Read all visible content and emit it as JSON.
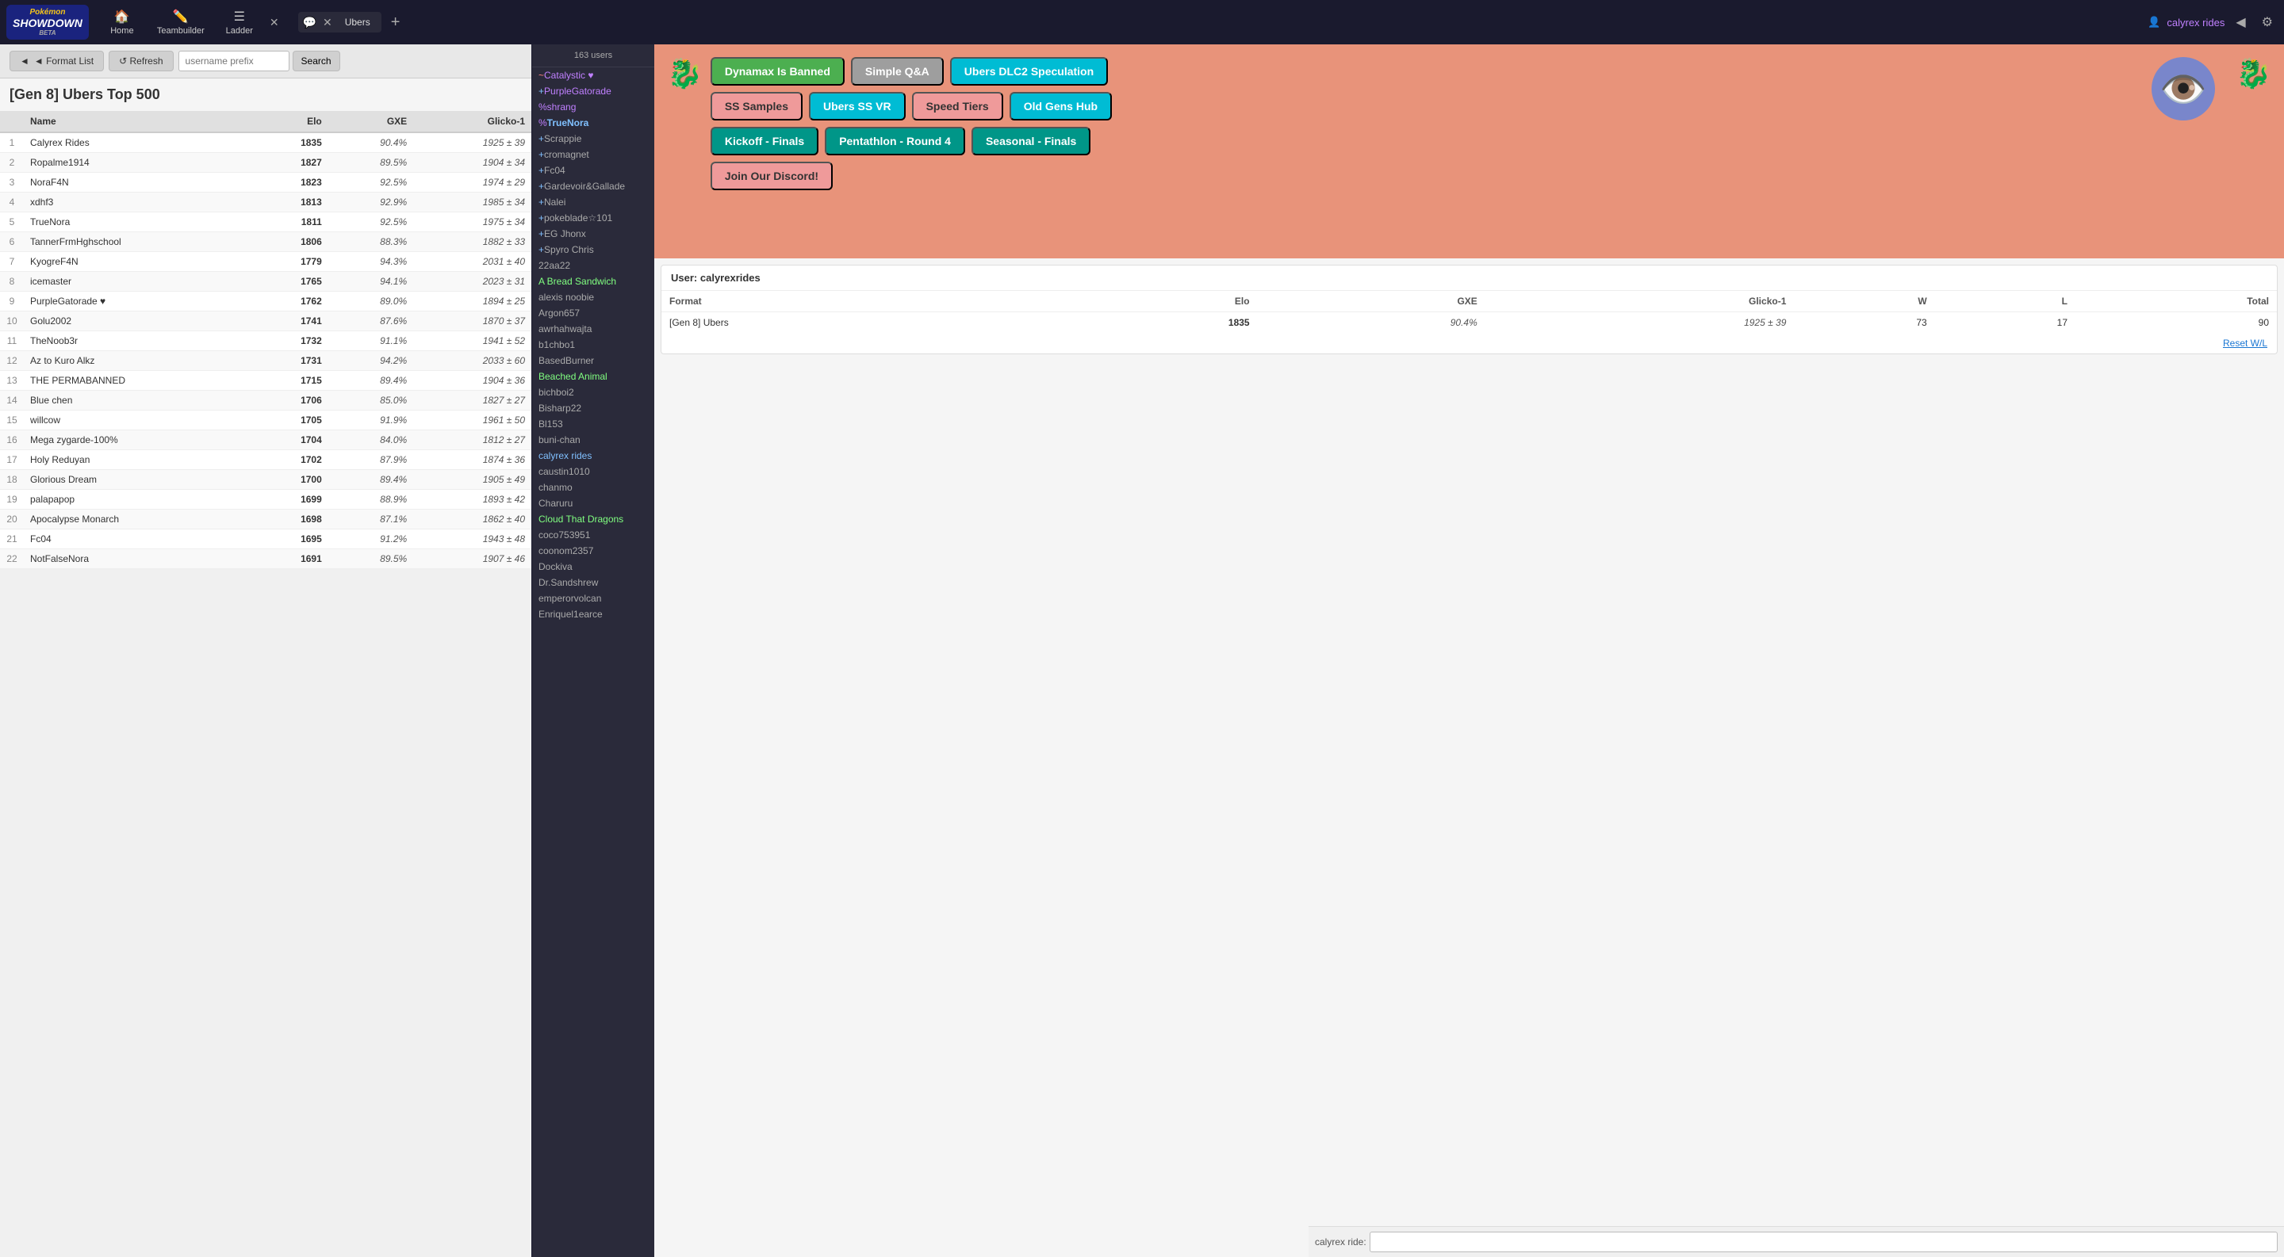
{
  "logo": {
    "pokemon": "Pokémon",
    "showdown": "SHOWDOWN",
    "beta": "BETA"
  },
  "nav": {
    "home_label": "Home",
    "teambuilder_label": "Teambuilder",
    "ladder_label": "Ladder",
    "ubers_tab": "Ubers",
    "add_tab": "+"
  },
  "user": {
    "name": "calyrex rides",
    "icon": "👤"
  },
  "toolbar": {
    "format_list_label": "◄ Format List",
    "refresh_label": "↺ Refresh",
    "search_placeholder": "username prefix",
    "search_label": "Search"
  },
  "ladder": {
    "title": "[Gen 8] Ubers Top 500",
    "columns": {
      "rank": "",
      "name": "Name",
      "elo": "Elo",
      "gxe": "GXE",
      "glicko": "Glicko-1"
    },
    "rows": [
      {
        "rank": 1,
        "name": "Calyrex Rides",
        "elo": "1835",
        "gxe": "90.4%",
        "glicko": "1925 ± 39"
      },
      {
        "rank": 2,
        "name": "Ropalme1914",
        "elo": "1827",
        "gxe": "89.5%",
        "glicko": "1904 ± 34"
      },
      {
        "rank": 3,
        "name": "NoraF4N",
        "elo": "1823",
        "gxe": "92.5%",
        "glicko": "1974 ± 29"
      },
      {
        "rank": 4,
        "name": "xdhf3",
        "elo": "1813",
        "gxe": "92.9%",
        "glicko": "1985 ± 34"
      },
      {
        "rank": 5,
        "name": "TrueNora",
        "elo": "1811",
        "gxe": "92.5%",
        "glicko": "1975 ± 34"
      },
      {
        "rank": 6,
        "name": "TannerFrmHghschool",
        "elo": "1806",
        "gxe": "88.3%",
        "glicko": "1882 ± 33"
      },
      {
        "rank": 7,
        "name": "KyogreF4N",
        "elo": "1779",
        "gxe": "94.3%",
        "glicko": "2031 ± 40"
      },
      {
        "rank": 8,
        "name": "icemaster",
        "elo": "1765",
        "gxe": "94.1%",
        "glicko": "2023 ± 31"
      },
      {
        "rank": 9,
        "name": "PurpleGatorade ♥",
        "elo": "1762",
        "gxe": "89.0%",
        "glicko": "1894 ± 25"
      },
      {
        "rank": 10,
        "name": "Golu2002",
        "elo": "1741",
        "gxe": "87.6%",
        "glicko": "1870 ± 37"
      },
      {
        "rank": 11,
        "name": "TheNoob3r",
        "elo": "1732",
        "gxe": "91.1%",
        "glicko": "1941 ± 52"
      },
      {
        "rank": 12,
        "name": "Az to Kuro Alkz",
        "elo": "1731",
        "gxe": "94.2%",
        "glicko": "2033 ± 60"
      },
      {
        "rank": 13,
        "name": "THE PERMABANNED",
        "elo": "1715",
        "gxe": "89.4%",
        "glicko": "1904 ± 36"
      },
      {
        "rank": 14,
        "name": "Blue chen",
        "elo": "1706",
        "gxe": "85.0%",
        "glicko": "1827 ± 27"
      },
      {
        "rank": 15,
        "name": "willcow",
        "elo": "1705",
        "gxe": "91.9%",
        "glicko": "1961 ± 50"
      },
      {
        "rank": 16,
        "name": "Mega zygarde-100%",
        "elo": "1704",
        "gxe": "84.0%",
        "glicko": "1812 ± 27"
      },
      {
        "rank": 17,
        "name": "Holy Reduyan",
        "elo": "1702",
        "gxe": "87.9%",
        "glicko": "1874 ± 36"
      },
      {
        "rank": 18,
        "name": "Glorious Dream",
        "elo": "1700",
        "gxe": "89.4%",
        "glicko": "1905 ± 49"
      },
      {
        "rank": 19,
        "name": "palapapop",
        "elo": "1699",
        "gxe": "88.9%",
        "glicko": "1893 ± 42"
      },
      {
        "rank": 20,
        "name": "Apocalypse Monarch",
        "elo": "1698",
        "gxe": "87.1%",
        "glicko": "1862 ± 40"
      },
      {
        "rank": 21,
        "name": "Fc04",
        "elo": "1695",
        "gxe": "91.2%",
        "glicko": "1943 ± 48"
      },
      {
        "rank": 22,
        "name": "NotFalseNora",
        "elo": "1691",
        "gxe": "89.5%",
        "glicko": "1907 ± 46"
      }
    ]
  },
  "users_panel": {
    "count": "163 users",
    "users": [
      {
        "name": "Catalystic ♥",
        "rank": "~",
        "color": "#c080ff"
      },
      {
        "name": "PurpleGatorade",
        "rank": "+",
        "color": "#c080ff"
      },
      {
        "name": "shrang",
        "rank": "%",
        "color": "#c080ff"
      },
      {
        "name": "TrueNora",
        "rank": "%",
        "color": "#80c0ff",
        "bold": true
      },
      {
        "name": "Scrappie",
        "rank": "+",
        "color": "#aaa"
      },
      {
        "name": "cromagnet",
        "rank": "+",
        "color": "#aaa"
      },
      {
        "name": "Fc04",
        "rank": "+",
        "color": "#aaa"
      },
      {
        "name": "Gardevoir&Gallade",
        "rank": "+",
        "color": "#aaa"
      },
      {
        "name": "Nalei",
        "rank": "+",
        "color": "#aaa"
      },
      {
        "name": "pokeblade☆101",
        "rank": "+",
        "color": "#aaa"
      },
      {
        "name": "EG Jhonx",
        "rank": "+",
        "color": "#aaa"
      },
      {
        "name": "Spyro Chris",
        "rank": "+",
        "color": "#aaa"
      },
      {
        "name": "22aa22",
        "rank": " ",
        "color": "#aaa"
      },
      {
        "name": "A Bread Sandwich",
        "rank": " ",
        "color": "#80ff80"
      },
      {
        "name": "alexis noobie",
        "rank": " ",
        "color": "#aaa"
      },
      {
        "name": "Argon657",
        "rank": " ",
        "color": "#aaa"
      },
      {
        "name": "awrhahwajta",
        "rank": " ",
        "color": "#aaa"
      },
      {
        "name": "b1chbo1",
        "rank": " ",
        "color": "#aaa"
      },
      {
        "name": "BasedBurner",
        "rank": " ",
        "color": "#aaa"
      },
      {
        "name": "Beached Animal",
        "rank": " ",
        "color": "#80ff80"
      },
      {
        "name": "bichboi2",
        "rank": " ",
        "color": "#aaa"
      },
      {
        "name": "Bisharp22",
        "rank": " ",
        "color": "#aaa"
      },
      {
        "name": "Bl153",
        "rank": " ",
        "color": "#aaa"
      },
      {
        "name": "buni-chan",
        "rank": " ",
        "color": "#aaa"
      },
      {
        "name": "calyrex rides",
        "rank": " ",
        "color": "#80c0ff"
      },
      {
        "name": "caustin1010",
        "rank": " ",
        "color": "#aaa"
      },
      {
        "name": "chanmo",
        "rank": " ",
        "color": "#aaa"
      },
      {
        "name": "Charuru",
        "rank": " ",
        "color": "#aaa"
      },
      {
        "name": "Cloud That Dragons",
        "rank": " ",
        "color": "#80ff80"
      },
      {
        "name": "coco753951",
        "rank": " ",
        "color": "#aaa"
      },
      {
        "name": "coonom2357",
        "rank": " ",
        "color": "#aaa"
      },
      {
        "name": "Dockiva",
        "rank": " ",
        "color": "#aaa"
      },
      {
        "name": "Dr.Sandshrew",
        "rank": " ",
        "color": "#aaa"
      },
      {
        "name": "emperorvolcan",
        "rank": " ",
        "color": "#aaa"
      },
      {
        "name": "Enriquel1earce",
        "rank": " ",
        "color": "#aaa"
      }
    ]
  },
  "room": {
    "tags": [
      {
        "label": "Dynamax Is Banned",
        "style": "tag-green"
      },
      {
        "label": "Simple Q&A",
        "style": "tag-gray"
      },
      {
        "label": "Ubers DLC2 Speculation",
        "style": "tag-cyan"
      },
      {
        "label": "SS Samples",
        "style": "tag-salmon"
      },
      {
        "label": "Ubers SS VR",
        "style": "tag-cyan"
      },
      {
        "label": "Speed Tiers",
        "style": "tag-salmon"
      },
      {
        "label": "Old Gens Hub",
        "style": "tag-cyan"
      },
      {
        "label": "Kickoff - Finals",
        "style": "tag-teal"
      },
      {
        "label": "Pentathlon - Round 4",
        "style": "tag-teal"
      },
      {
        "label": "Seasonal - Finals",
        "style": "tag-teal"
      },
      {
        "label": "Join Our Discord!",
        "style": "tag-salmon"
      }
    ]
  },
  "stats": {
    "label": "User:",
    "username": "calyrexrides",
    "columns": {
      "format": "Format",
      "elo": "Elo",
      "gxe": "GXE",
      "glicko": "Glicko-1",
      "w": "W",
      "l": "L",
      "total": "Total"
    },
    "row": {
      "format": "[Gen 8] Ubers",
      "elo": "1835",
      "gxe": "90.4%",
      "glicko": "1925 ± 39",
      "w": "73",
      "l": "17",
      "total": "90"
    },
    "reset_label": "Reset W/L"
  },
  "chat": {
    "username_label": "calyrex ride:",
    "input_placeholder": ""
  }
}
